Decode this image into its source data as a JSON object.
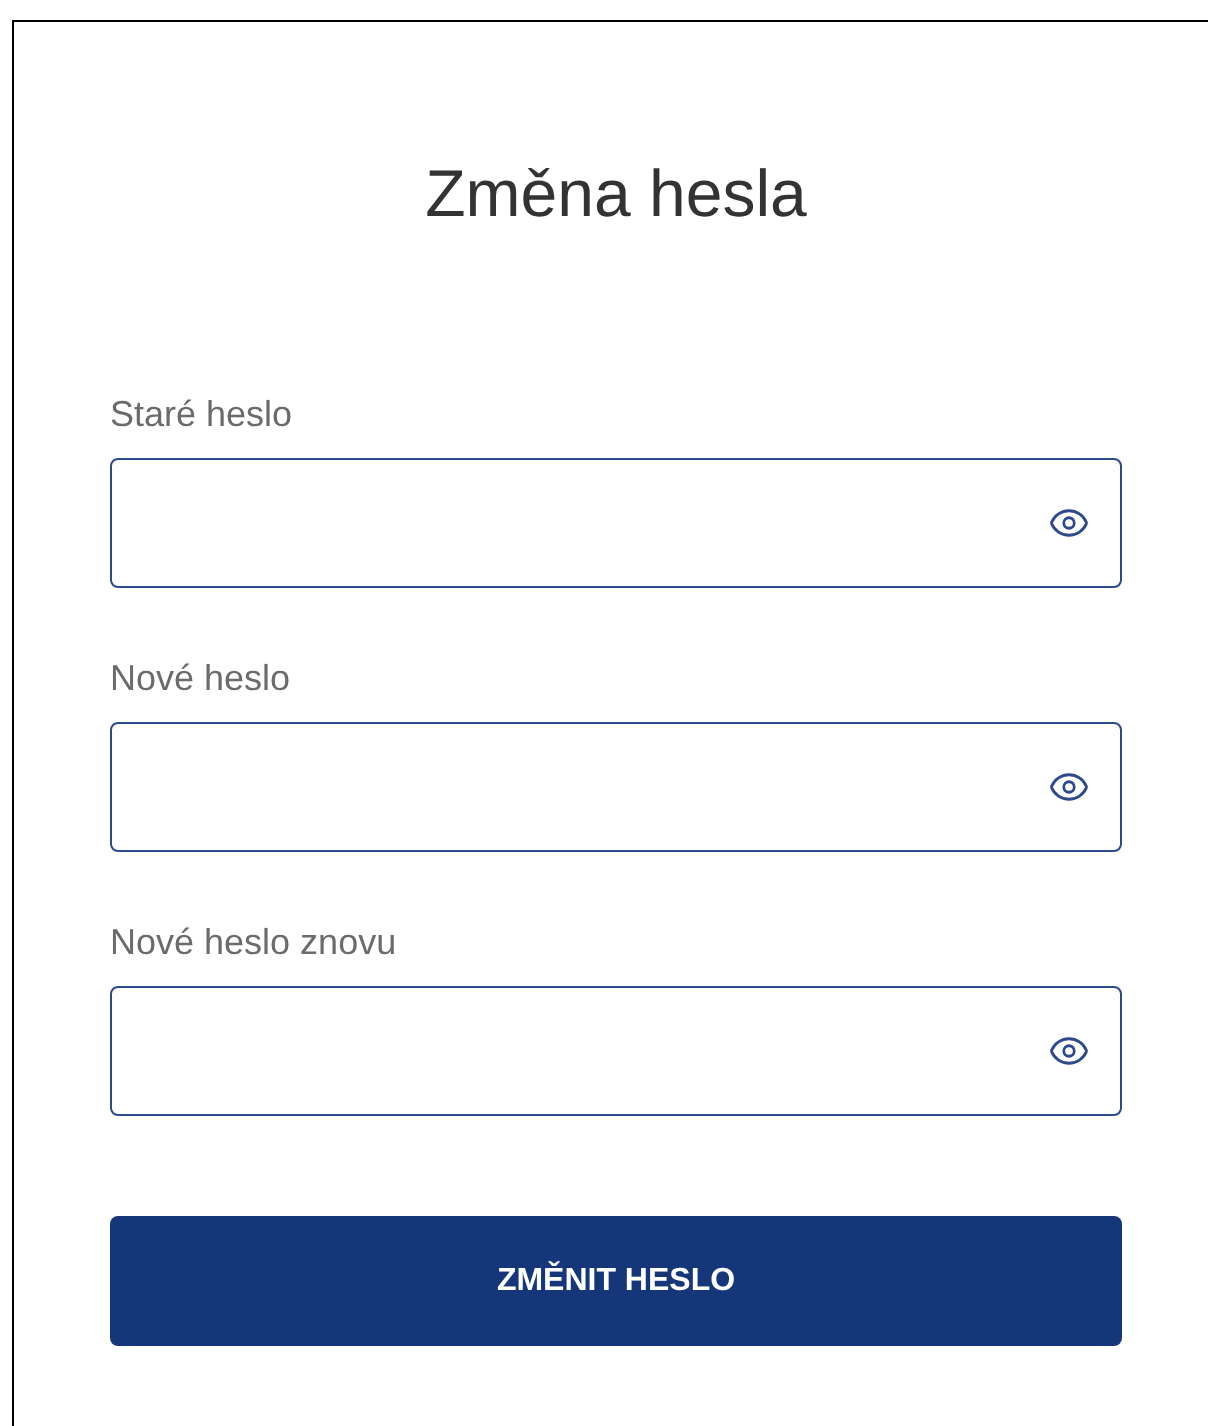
{
  "title": "Změna hesla",
  "fields": [
    {
      "label": "Staré heslo"
    },
    {
      "label": "Nové heslo"
    },
    {
      "label": "Nové heslo znovu"
    }
  ],
  "submit_button": "ZMĚNIT HESLO"
}
